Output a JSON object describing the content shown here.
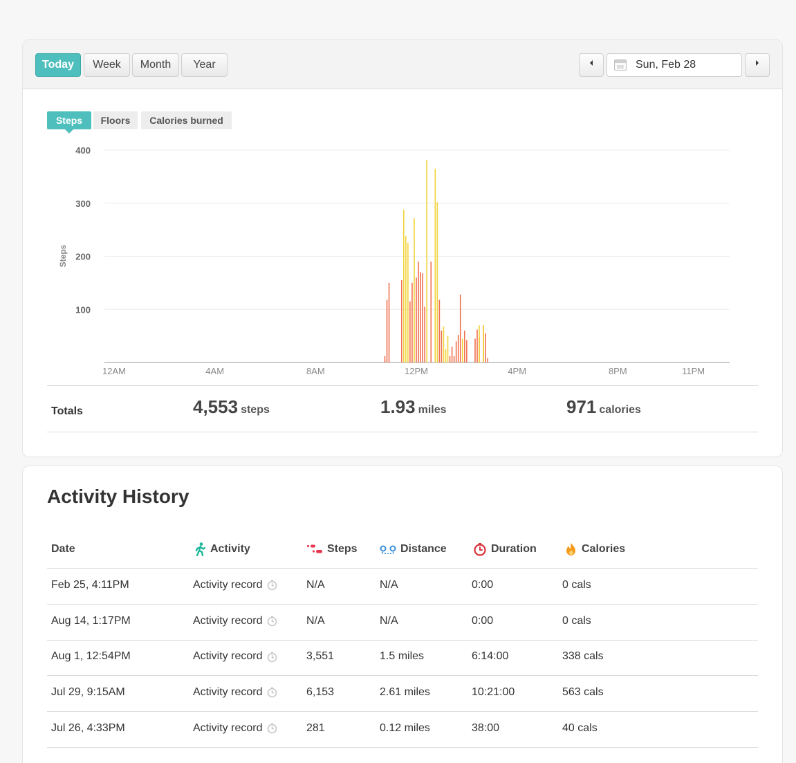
{
  "toolbar": {
    "range_buttons": [
      "Today",
      "Week",
      "Month",
      "Year"
    ],
    "active_range": "Today",
    "date": "Sun, Feb 28",
    "prev_icon": "triangle-left-icon",
    "next_icon": "triangle-right-icon",
    "calendar_icon": "calendar-icon"
  },
  "metric_tabs": [
    "Steps",
    "Floors",
    "Calories burned"
  ],
  "active_metric": "Steps",
  "chart_data": {
    "type": "bar",
    "ylabel": "Steps",
    "xlabel": "",
    "ylim": [
      0,
      400
    ],
    "yticks": [
      100,
      200,
      300,
      400
    ],
    "xlim": [
      0,
      1440
    ],
    "xticks": [
      {
        "label": "12AM",
        "minute": 0
      },
      {
        "label": "4AM",
        "minute": 240
      },
      {
        "label": "8AM",
        "minute": 480
      },
      {
        "label": "12PM",
        "minute": 720
      },
      {
        "label": "4PM",
        "minute": 960
      },
      {
        "label": "8PM",
        "minute": 1200
      },
      {
        "label": "11PM",
        "minute": 1380
      }
    ],
    "grid": true,
    "series": [
      {
        "name": "",
        "color": "#f0714f",
        "values": [
          [
            645,
            12
          ],
          [
            650,
            118
          ],
          [
            655,
            150
          ],
          [
            685,
            155
          ],
          [
            705,
            115
          ],
          [
            710,
            150
          ],
          [
            720,
            160
          ],
          [
            725,
            190
          ],
          [
            730,
            170
          ],
          [
            735,
            168
          ],
          [
            740,
            105
          ],
          [
            755,
            190
          ],
          [
            775,
            118
          ],
          [
            780,
            60
          ],
          [
            800,
            12
          ],
          [
            805,
            30
          ],
          [
            810,
            12
          ],
          [
            815,
            40
          ],
          [
            820,
            52
          ],
          [
            825,
            128
          ],
          [
            835,
            60
          ],
          [
            840,
            42
          ],
          [
            860,
            45
          ],
          [
            865,
            62
          ],
          [
            870,
            48
          ],
          [
            880,
            70
          ],
          [
            885,
            55
          ],
          [
            890,
            8
          ]
        ]
      },
      {
        "name": "",
        "color": "#f1d33a",
        "values": [
          [
            690,
            288
          ],
          [
            695,
            238
          ],
          [
            700,
            225
          ],
          [
            715,
            272
          ],
          [
            745,
            382
          ],
          [
            765,
            365
          ],
          [
            770,
            302
          ],
          [
            785,
            68
          ],
          [
            790,
            25
          ],
          [
            795,
            50
          ],
          [
            830,
            45
          ],
          [
            870,
            70
          ],
          [
            880,
            70
          ]
        ]
      }
    ]
  },
  "totals": {
    "label": "Totals",
    "steps": "4,553",
    "steps_unit": "steps",
    "miles": "1.93",
    "miles_unit": "miles",
    "calories": "971",
    "calories_unit": "calories"
  },
  "history": {
    "title": "Activity History",
    "columns": [
      {
        "label": "Date",
        "icon": ""
      },
      {
        "label": "Activity",
        "icon": "walking-person-icon",
        "color": "#1fb79b"
      },
      {
        "label": "Steps",
        "icon": "footsteps-icon",
        "color": "#e8354f"
      },
      {
        "label": "Distance",
        "icon": "distance-icon",
        "color": "#3d8fd8"
      },
      {
        "label": "Duration",
        "icon": "stopwatch-icon",
        "color": "#d9313a"
      },
      {
        "label": "Calories",
        "icon": "flame-icon",
        "color": "#f59b1c"
      }
    ],
    "rows": [
      {
        "date": "Feb 25, 4:11PM",
        "activity": "Activity record",
        "steps": "N/A",
        "distance": "N/A",
        "duration": "0:00",
        "calories": "0 cals"
      },
      {
        "date": "Aug 14, 1:17PM",
        "activity": "Activity record",
        "steps": "N/A",
        "distance": "N/A",
        "duration": "0:00",
        "calories": "0 cals"
      },
      {
        "date": "Aug 1, 12:54PM",
        "activity": "Activity record",
        "steps": "3,551",
        "distance": "1.5 miles",
        "duration": "6:14:00",
        "calories": "338 cals"
      },
      {
        "date": "Jul 29, 9:15AM",
        "activity": "Activity record",
        "steps": "6,153",
        "distance": "2.61 miles",
        "duration": "10:21:00",
        "calories": "563 cals"
      },
      {
        "date": "Jul 26, 4:33PM",
        "activity": "Activity record",
        "steps": "281",
        "distance": "0.12 miles",
        "duration": "38:00",
        "calories": "40 cals"
      }
    ]
  }
}
